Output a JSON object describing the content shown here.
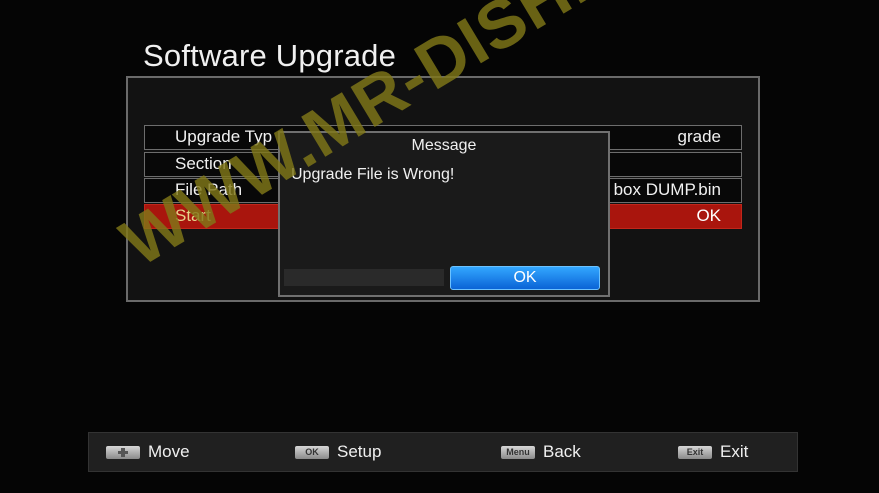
{
  "screen": {
    "title": "Software Upgrade"
  },
  "rows": [
    {
      "label": "Upgrade Typ",
      "value": "grade"
    },
    {
      "label": "Section",
      "value": ""
    },
    {
      "label": "File Path",
      "value": "box DUMP.bin"
    },
    {
      "label": "Start",
      "value": "OK"
    }
  ],
  "dialog": {
    "title": "Message",
    "message": "Upgrade File is Wrong!",
    "ok_label": "OK"
  },
  "watermark": "WWW.MR-DISH.COM",
  "footer": [
    {
      "badge": "",
      "label": "Move",
      "icon": "dpad-key-icon"
    },
    {
      "badge": "OK",
      "label": "Setup",
      "icon": "ok-key-icon"
    },
    {
      "badge": "Menu",
      "label": "Back",
      "icon": "menu-key-icon"
    },
    {
      "badge": "Exit",
      "label": "Exit",
      "icon": "exit-key-icon"
    }
  ],
  "colors": {
    "selected_row": "#a9150d",
    "ok_button": "#1f8cf0",
    "watermark": "#807818"
  }
}
